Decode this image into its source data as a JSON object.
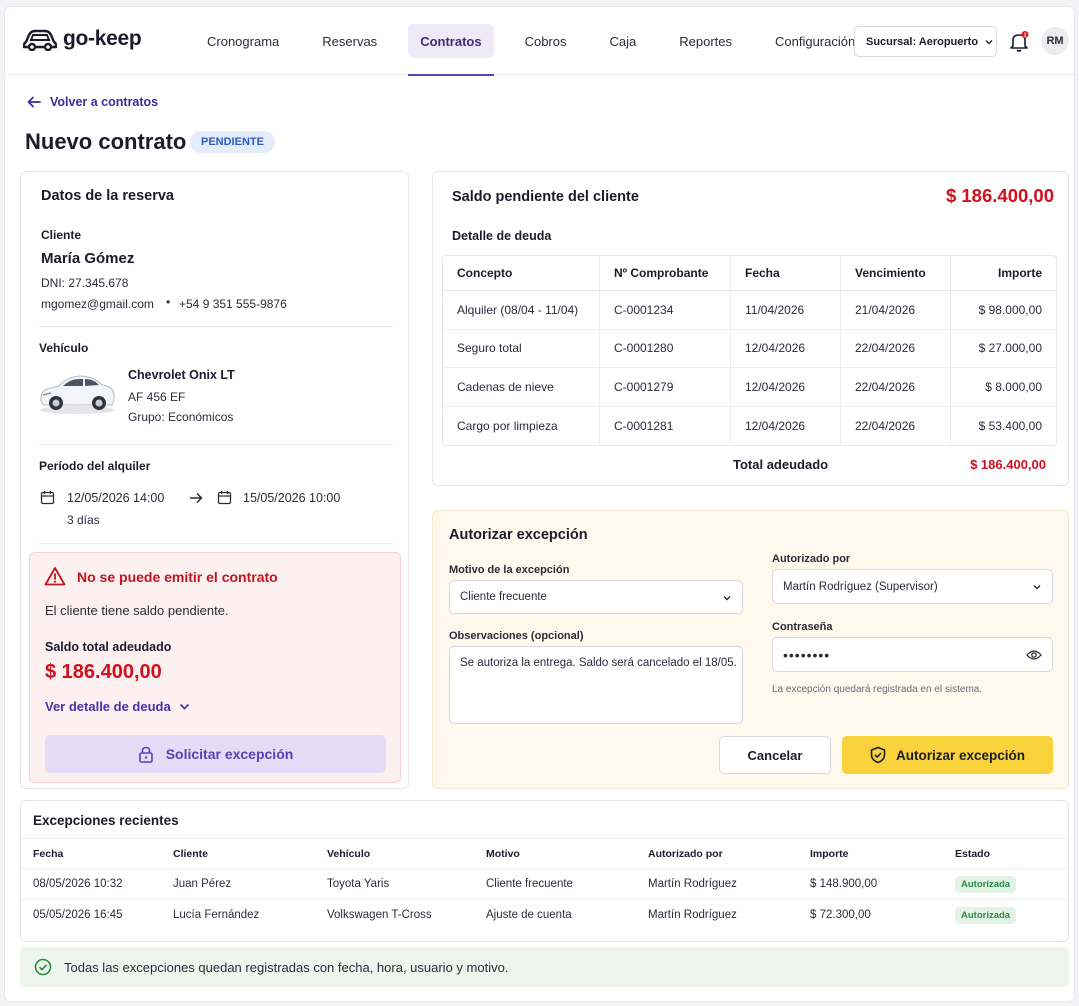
{
  "brand": {
    "name": "go-keep"
  },
  "nav": [
    {
      "label": "Cronograma"
    },
    {
      "label": "Reservas"
    },
    {
      "label": "Contratos",
      "active": true
    },
    {
      "label": "Cobros"
    },
    {
      "label": "Caja"
    },
    {
      "label": "Reportes"
    },
    {
      "label": "Configuración"
    }
  ],
  "header": {
    "branch": "Sucursal: Aeropuerto",
    "notifications": "1",
    "user_initials": "RM"
  },
  "page": {
    "back_label": "Volver a contratos",
    "title": "Nuevo contrato",
    "status": "PENDIENTE"
  },
  "reservation": {
    "title": "Datos de la reserva",
    "client_label": "Cliente",
    "client_name": "María Gómez",
    "dni": "DNI: 27.345.678",
    "email": "mgomez@gmail.com",
    "phone": "+54 9 351 555-9876",
    "vehicle_label": "Vehículo",
    "vehicle_name": "Chevrolet Onix LT",
    "plate": "AF 456 EF",
    "group": "Grupo: Económicos",
    "period_label": "Período del alquiler",
    "start": "12/05/2026 14:00",
    "end": "15/05/2026 10:00",
    "duration": "3 días"
  },
  "alert": {
    "title": "No se puede emitir el contrato",
    "text": "El cliente tiene saldo pendiente.",
    "total_label": "Saldo total adeudado",
    "total": "$ 186.400,00",
    "detail_link": "Ver detalle de deuda",
    "request_button": "Solicitar excepción"
  },
  "debt": {
    "title": "Saldo pendiente del cliente",
    "amount": "$ 186.400,00",
    "subtitle": "Detalle de deuda",
    "columns": [
      "Concepto",
      "Nº Comprobante",
      "Fecha",
      "Vencimiento",
      "Importe"
    ],
    "rows": [
      [
        "Alquiler (08/04 - 11/04)",
        "C-0001234",
        "11/04/2026",
        "21/04/2026",
        "$ 98.000,00"
      ],
      [
        "Seguro total",
        "C-0001280",
        "12/04/2026",
        "22/04/2026",
        "$ 27.000,00"
      ],
      [
        "Cadenas de nieve",
        "C-0001279",
        "12/04/2026",
        "22/04/2026",
        "$ 8.000,00"
      ],
      [
        "Cargo por limpieza",
        "C-0001281",
        "12/04/2026",
        "22/04/2026",
        "$ 53.400,00"
      ]
    ],
    "total_label": "Total adeudado",
    "total": "$ 186.400,00"
  },
  "exception": {
    "title": "Autorizar excepción",
    "reason_label": "Motivo de la excepción",
    "reason_value": "Cliente frecuente",
    "notes_label": "Observaciones (opcional)",
    "notes_value": "Se autoriza la entrega. Saldo será cancelado el 18/05.",
    "authorized_label": "Autorizado por",
    "authorized_value": "Martín Rodríguez (Supervisor)",
    "password_label": "Contraseña",
    "password_value": "••••••••",
    "note": "La excepción quedará registrada en el sistema.",
    "cancel": "Cancelar",
    "authorize": "Autorizar excepción"
  },
  "recent": {
    "title": "Excepciones recientes",
    "columns": [
      "Fecha",
      "Cliente",
      "Vehículo",
      "Motivo",
      "Autorizado por",
      "Importe",
      "Estado"
    ],
    "rows": [
      [
        "08/05/2026 10:32",
        "Juan Pérez",
        "Toyota Yaris",
        "Cliente frecuente",
        "Martín Rodríguez",
        "$ 148.900,00",
        "Autorizada"
      ],
      [
        "05/05/2026 16:45",
        "Lucía Fernández",
        "Volkswagen T-Cross",
        "Ajuste de cuenta",
        "Martín Rodríguez",
        "$ 72.300,00",
        "Autorizada"
      ]
    ]
  },
  "footer_note": "Todas las excepciones quedan registradas con fecha, hora, usuario y motivo.",
  "colors": {
    "accent": "#5b3fc4",
    "danger": "#d0101c",
    "warning_button": "#f8d23a",
    "success": "#2a8a44"
  }
}
